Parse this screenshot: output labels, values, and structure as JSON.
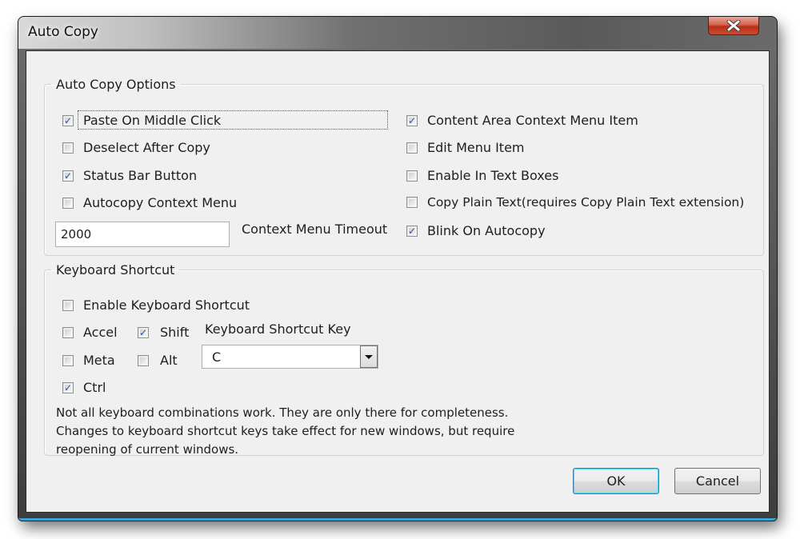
{
  "window": {
    "title": "Auto Copy",
    "close_icon": "close-x-icon"
  },
  "auto_copy_options": {
    "legend": "Auto Copy Options",
    "left_checkboxes": [
      {
        "label": "Paste On Middle Click",
        "checked": true,
        "focused": true
      },
      {
        "label": "Deselect After Copy",
        "checked": false
      },
      {
        "label": "Status Bar Button",
        "checked": true
      },
      {
        "label": "Autocopy Context Menu",
        "checked": false
      }
    ],
    "right_checkboxes": [
      {
        "label": "Content Area Context Menu Item",
        "checked": true
      },
      {
        "label": "Edit Menu Item",
        "checked": false
      },
      {
        "label": "Enable In Text Boxes",
        "checked": false
      },
      {
        "label": "Copy Plain Text(requires Copy Plain Text extension)",
        "checked": false
      },
      {
        "label": "Blink On Autocopy",
        "checked": true
      }
    ],
    "timeout": {
      "value": "2000",
      "label": "Context Menu Timeout"
    }
  },
  "keyboard_shortcut": {
    "legend": "Keyboard Shortcut",
    "enable": {
      "label": "Enable Keyboard Shortcut",
      "checked": false
    },
    "modifiers": [
      {
        "label": "Accel",
        "checked": false
      },
      {
        "label": "Shift",
        "checked": true
      },
      {
        "label": "Meta",
        "checked": false
      },
      {
        "label": "Alt",
        "checked": false
      },
      {
        "label": "Ctrl",
        "checked": true
      }
    ],
    "key_label": "Keyboard Shortcut Key",
    "key_value": "C",
    "note_lines": [
      "Not all keyboard combinations work. They are only there for completeness.",
      "Changes to keyboard shortcut keys take effect for new windows, but require",
      "reopening of current windows."
    ]
  },
  "buttons": {
    "ok": "OK",
    "cancel": "Cancel"
  },
  "colors": {
    "tick": "#2d4ea0",
    "close_button": "#c94d35",
    "default_button_glow": "#48d4f5",
    "window_accent": "#32a6d6"
  }
}
